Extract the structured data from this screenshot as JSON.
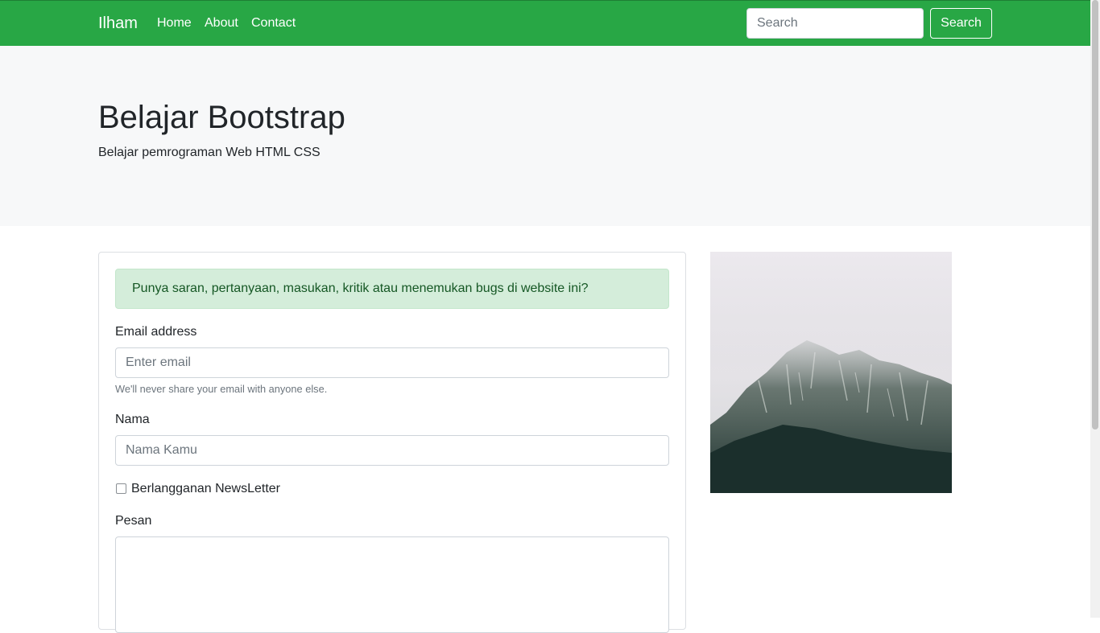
{
  "navbar": {
    "brand": "Ilham",
    "links": [
      "Home",
      "About",
      "Contact"
    ],
    "search_placeholder": "Search",
    "search_button": "Search"
  },
  "jumbotron": {
    "title": "Belajar Bootstrap",
    "lead": "Belajar pemrograman Web HTML CSS"
  },
  "form": {
    "alert": "Punya saran, pertanyaan, masukan, kritik atau menemukan bugs di website ini?",
    "email_label": "Email address",
    "email_placeholder": "Enter email",
    "email_help": "We'll never share your email with anyone else.",
    "name_label": "Nama",
    "name_placeholder": "Nama Kamu",
    "newsletter_label": "Berlangganan NewsLetter",
    "message_label": "Pesan"
  },
  "colors": {
    "navbar": "#28a745",
    "jumbotron": "#f7f8f9",
    "alert_bg": "#d4edda",
    "alert_text": "#155724"
  },
  "image": {
    "subject": "foggy-mountain-photo"
  }
}
